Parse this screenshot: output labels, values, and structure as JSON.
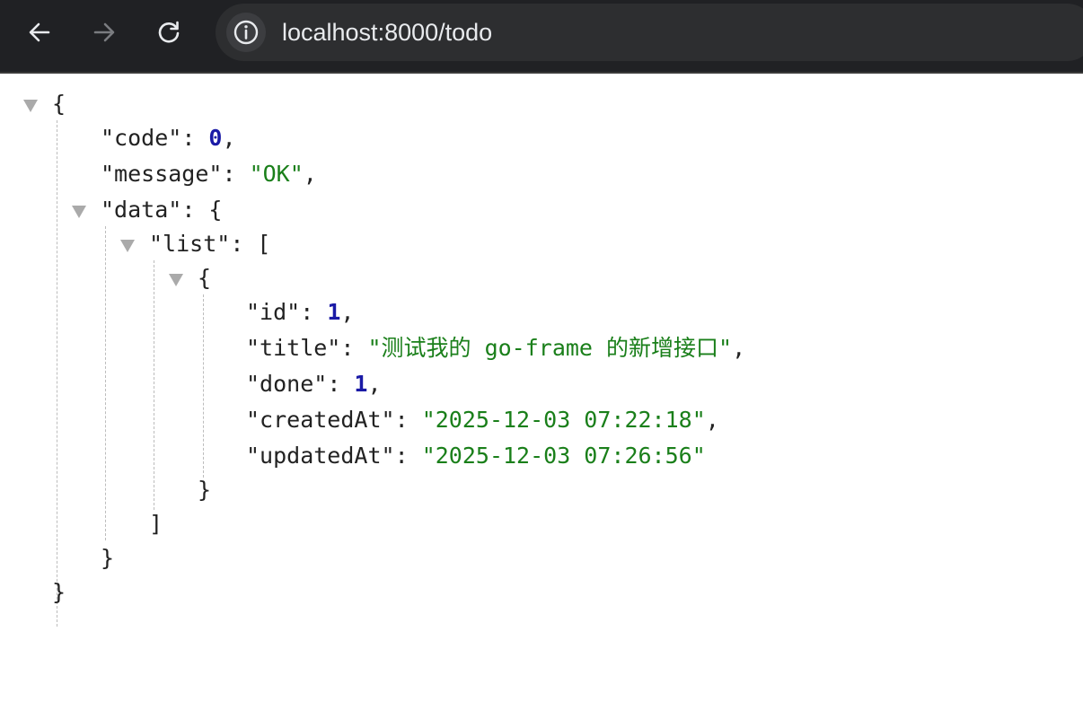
{
  "browser": {
    "url": "localhost:8000/todo"
  },
  "json": {
    "open_brace": "{",
    "close_brace": "}",
    "open_bracket": "[",
    "close_bracket": "]",
    "code": {
      "key": "\"code\"",
      "value": "0"
    },
    "message": {
      "key": "\"message\"",
      "value": "\"OK\""
    },
    "data": {
      "key": "\"data\"",
      "list": {
        "key": "\"list\"",
        "items": [
          {
            "id": {
              "key": "\"id\"",
              "value": "1"
            },
            "title": {
              "key": "\"title\"",
              "value": "\"测试我的 go-frame 的新增接口\""
            },
            "done": {
              "key": "\"done\"",
              "value": "1"
            },
            "createdAt": {
              "key": "\"createdAt\"",
              "value": "\"2025-12-03 07:22:18\""
            },
            "updatedAt": {
              "key": "\"updatedAt\"",
              "value": "\"2025-12-03 07:26:56\""
            }
          }
        ]
      }
    }
  }
}
